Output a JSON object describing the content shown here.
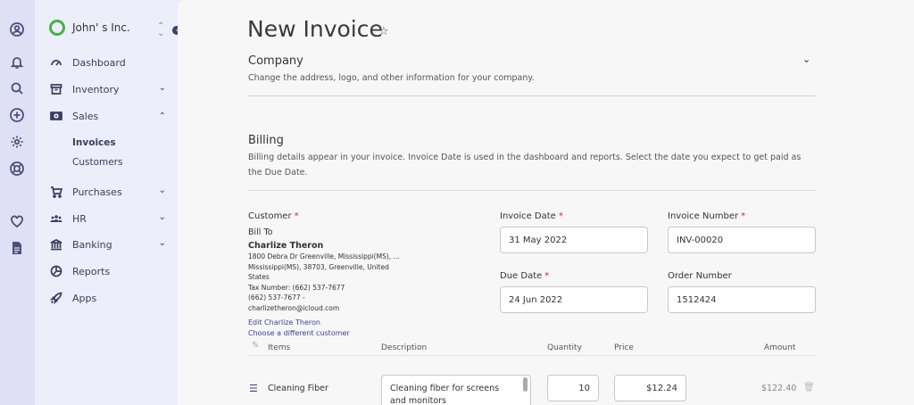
{
  "rail": {
    "icons": [
      "user-circle-icon",
      "bell-icon",
      "search-icon",
      "plus-circle-icon",
      "gear-icon",
      "lifebuoy-icon",
      "heart-icon",
      "document-icon"
    ]
  },
  "sidebar": {
    "company": "John' s Inc.",
    "items": [
      {
        "label": "Dashboard"
      },
      {
        "label": "Inventory"
      },
      {
        "label": "Sales"
      },
      {
        "label": "Purchases"
      },
      {
        "label": "HR"
      },
      {
        "label": "Banking"
      },
      {
        "label": "Reports"
      },
      {
        "label": "Apps"
      }
    ],
    "sales_sub": [
      {
        "label": "Invoices"
      },
      {
        "label": "Customers"
      }
    ]
  },
  "page": {
    "title": "New Invoice"
  },
  "company_section": {
    "title": "Company",
    "description": "Change the address, logo, and other information for your company."
  },
  "billing_section": {
    "title": "Billing",
    "description": "Billing details appear in your invoice. Invoice Date is used in the dashboard and reports. Select the date you expect to get paid as the Due Date."
  },
  "customer": {
    "label": "Customer",
    "bill_to": "Bill To",
    "name": "Charlize Theron",
    "address_line1": "1800 Debra Dr Greenville, Mississippi(MS), ...",
    "address_line2": "Mississippi(MS), 38703, Greenville, United",
    "address_line3": "States",
    "tax_number": "Tax Number: (662) 537-7677",
    "phone": "(662) 537-7677   -",
    "email": "charlizetheron@icloud.com",
    "edit_link": "Edit Charlize Theron",
    "choose_link": "Choose a different customer"
  },
  "fields": {
    "invoice_date_label": "Invoice Date",
    "invoice_date_value": "31 May 2022",
    "invoice_number_label": "Invoice Number",
    "invoice_number_value": "INV-00020",
    "due_date_label": "Due Date",
    "due_date_value": "24 Jun 2022",
    "order_number_label": "Order Number",
    "order_number_value": "1512424",
    "required_mark": "*"
  },
  "items_table": {
    "headers": {
      "items": "Items",
      "description": "Description",
      "quantity": "Quantity",
      "price": "Price",
      "amount": "Amount"
    },
    "rows": [
      {
        "item": "Cleaning Fiber",
        "description": "Cleaning fiber for screens and monitors",
        "quantity": "10",
        "price": "$12.24",
        "amount": "$122.40"
      }
    ]
  }
}
